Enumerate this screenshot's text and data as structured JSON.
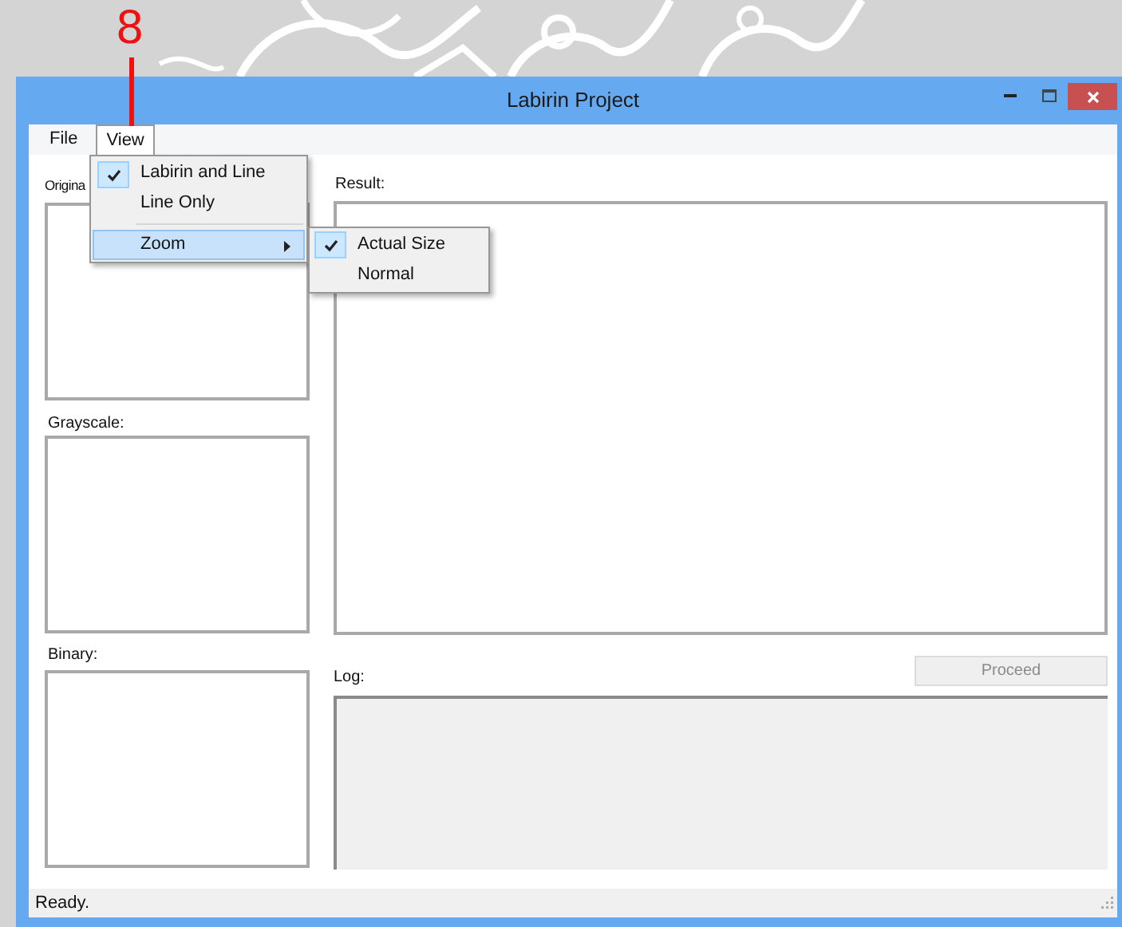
{
  "callout": {
    "label": "8"
  },
  "window": {
    "title": "Labirin Project"
  },
  "menu_bar": [
    {
      "label": "File",
      "selected": false
    },
    {
      "label": "View",
      "selected": true
    }
  ],
  "view_menu": {
    "items": [
      {
        "kind": "item",
        "label": "Labirin and Line",
        "checked": true,
        "selected": false
      },
      {
        "kind": "item",
        "label": "Line Only",
        "checked": false,
        "selected": false
      },
      {
        "kind": "separator"
      },
      {
        "kind": "submenu",
        "label": "Zoom",
        "checked": false,
        "selected": true
      }
    ]
  },
  "zoom_submenu": {
    "items": [
      {
        "label": "Actual Size",
        "checked": true
      },
      {
        "label": "Normal",
        "checked": false
      }
    ]
  },
  "left_panels": [
    {
      "label": "Origina"
    },
    {
      "label": "Grayscale:"
    },
    {
      "label": "Binary:"
    }
  ],
  "result": {
    "label": "Result:"
  },
  "proceed_button": {
    "label": "Proceed",
    "disabled": true
  },
  "log": {
    "label": "Log:"
  },
  "status_bar": {
    "text": "Ready."
  }
}
